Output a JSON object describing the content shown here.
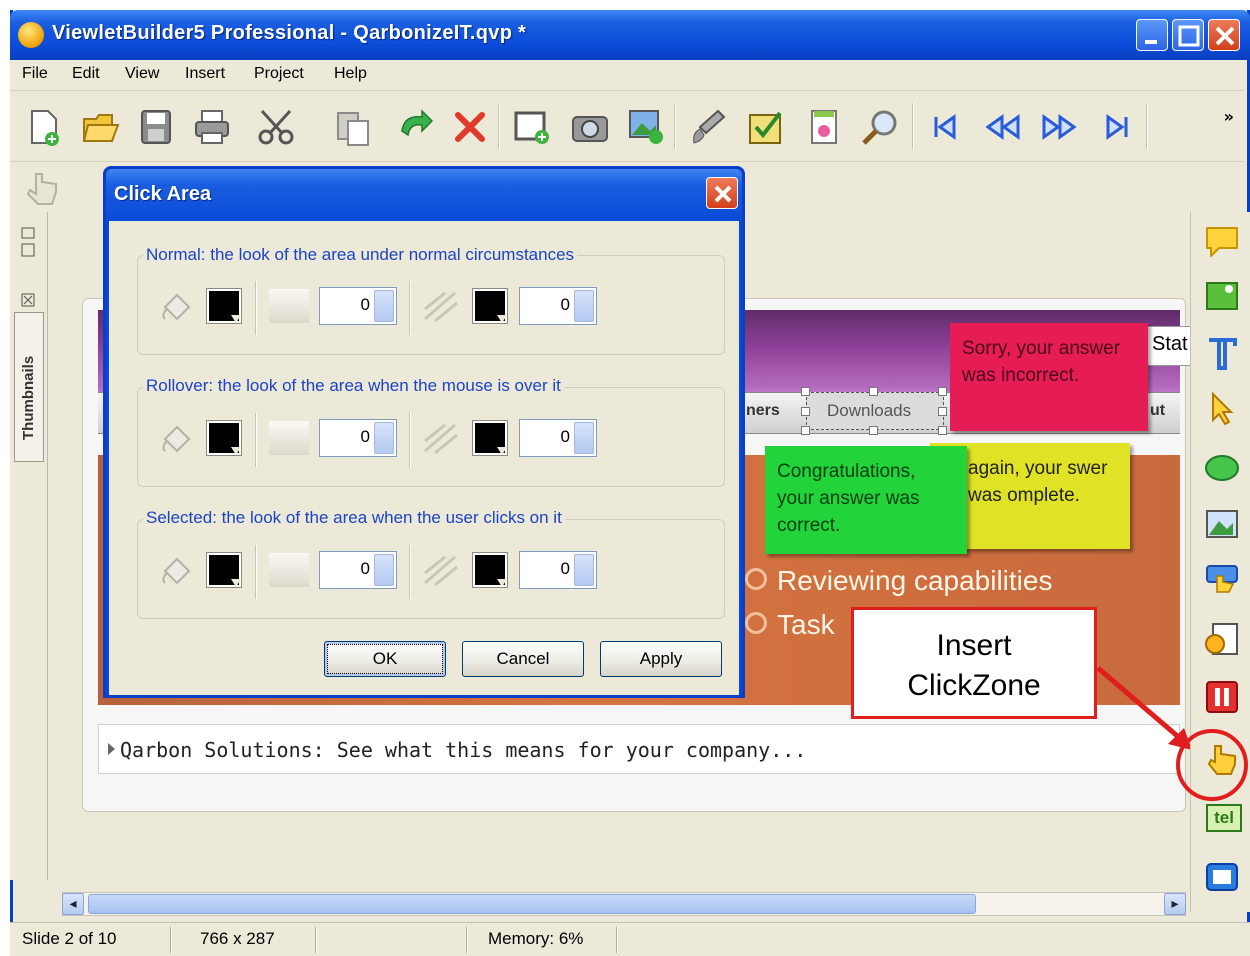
{
  "window": {
    "title": "ViewletBuilder5 Professional - QarbonizeIT.qvp *"
  },
  "menu": [
    "File",
    "Edit",
    "View",
    "Insert",
    "Project",
    "Help"
  ],
  "toolbar": {
    "icons": [
      "new-icon",
      "open-icon",
      "save-icon",
      "print-icon",
      "cut-icon",
      "paste-icon",
      "undo-icon",
      "delete-icon",
      "add-frame-icon",
      "capture-icon",
      "insert-image-icon",
      "brush-icon",
      "quiz-icon",
      "publish-icon",
      "zoom-icon",
      "first-icon",
      "rewind-icon",
      "forward-icon",
      "last-icon"
    ],
    "more": "»"
  },
  "left_panel": {
    "thumbnails_label": "Thumbnails"
  },
  "dialog": {
    "title": "Click Area",
    "groups": [
      {
        "label": "Normal: the look of the area under normal circumstances",
        "value1": "0",
        "value2": "0"
      },
      {
        "label": "Rollover: the look of the area when the mouse is over it",
        "value1": "0",
        "value2": "0"
      },
      {
        "label": "Selected: the look of the area when the user clicks on it",
        "value1": "0",
        "value2": "0"
      }
    ],
    "buttons": {
      "ok": "OK",
      "cancel": "Cancel",
      "apply": "Apply"
    }
  },
  "slide": {
    "nav_left": "ners",
    "downloads": "Downloads",
    "nav_right": "ut",
    "stat": "Stat",
    "bullets": [
      "Reviewing capabilities",
      "Task"
    ],
    "bottom_text": "Qarbon Solutions: See what this means for your company..."
  },
  "notes": {
    "red": "Sorry, your answer was incorrect.",
    "yellow": "again, your swer was omplete.",
    "green": "Congratulations, your answer was correct."
  },
  "callout": {
    "line1": "Insert",
    "line2": "ClickZone"
  },
  "right_panel": {
    "icons": [
      "callout-icon",
      "highlight-icon",
      "text-icon",
      "pointer-icon",
      "shape-icon",
      "image-icon",
      "button-icon",
      "media-icon",
      "pause-icon",
      "clickzone-icon",
      "textfield-icon",
      "flash-icon"
    ],
    "textfield_label": "tel"
  },
  "statusbar": {
    "slide": "Slide 2 of 10",
    "size": "766 x 287",
    "memory": "Memory: 6%"
  },
  "colors": {
    "titlebar": "#0a4bd8",
    "dialog_label": "#1a44c4",
    "note_red": "#e61c54",
    "note_yellow": "#e0e325",
    "note_green": "#22d33a",
    "callout_border": "#e01e1e"
  }
}
